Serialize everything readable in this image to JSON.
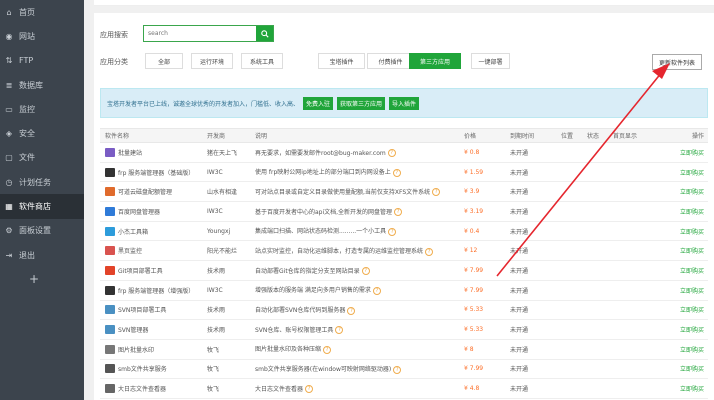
{
  "sidebar": {
    "items": [
      {
        "label": "首页",
        "icon": "home-icon",
        "glyph": "⌂"
      },
      {
        "label": "网站",
        "icon": "globe-icon",
        "glyph": "◉"
      },
      {
        "label": "FTP",
        "icon": "ftp-icon",
        "glyph": "⇅"
      },
      {
        "label": "数据库",
        "icon": "database-icon",
        "glyph": "≣"
      },
      {
        "label": "监控",
        "icon": "monitor-icon",
        "glyph": "▭"
      },
      {
        "label": "安全",
        "icon": "shield-icon",
        "glyph": "◈"
      },
      {
        "label": "文件",
        "icon": "folder-icon",
        "glyph": "▢"
      },
      {
        "label": "计划任务",
        "icon": "clock-icon",
        "glyph": "◷"
      },
      {
        "label": "软件商店",
        "icon": "grid-icon",
        "glyph": "▦"
      },
      {
        "label": "面板设置",
        "icon": "gear-icon",
        "glyph": "⚙"
      },
      {
        "label": "退出",
        "icon": "logout-icon",
        "glyph": "⇥"
      }
    ],
    "active_index": 8,
    "add_glyph": "+"
  },
  "search": {
    "label": "应用搜索",
    "placeholder": "search"
  },
  "categories": {
    "label": "应用分类",
    "items": [
      "全部",
      "运行环境",
      "系统工具",
      "宝塔插件",
      "付费插件",
      "第三方应用",
      "一键部署"
    ],
    "active_index": 5
  },
  "update_button": "更新软件列表",
  "notice": {
    "text": "宝塔开发者平台已上线，诚邀全球优秀的开发者加入，门槛低、收入高、",
    "buttons": [
      "免费入驻",
      "获取第三方应用",
      "导入插件"
    ]
  },
  "table": {
    "headers": [
      "软件名称",
      "开发商",
      "说明",
      "价格",
      "到期时间",
      "位置",
      "状态",
      "首页显示",
      "操作"
    ],
    "rows": [
      {
        "name": "批量建站",
        "dev": "猪在天上飞",
        "desc": "再无要求，如需要发邮件root@bug-maker.com",
        "price": "¥ 0.8",
        "expire": "未开通",
        "op": "立即购买",
        "color": "#7a5cc4"
      },
      {
        "name": "frp 服务端管理器（基础版）",
        "dev": "IW3C",
        "desc": "使用 frp映射公网ip地址上的部分端口到内网设备上",
        "price": "¥ 1.59",
        "expire": "未开通",
        "op": "立即购买",
        "color": "#333333"
      },
      {
        "name": "可道云磁盘配额管理",
        "dev": "山水有相逢",
        "desc": "可对站点目录或自定义目录做使用量配额,当前仅支持XFS文件系统",
        "price": "¥ 3.9",
        "expire": "未开通",
        "op": "立即购买",
        "color": "#e06b2c"
      },
      {
        "name": "百度网盘管理器",
        "dev": "IW3C",
        "desc": "基于百度开发者中心的api文档,全新开发的网盘管理",
        "price": "¥ 3.19",
        "expire": "未开通",
        "op": "立即购买",
        "color": "#2f7bd8"
      },
      {
        "name": "小杰工具箱",
        "dev": "Youngxj",
        "desc": "集成端口扫描、网站状态码检测.........一个小工具",
        "price": "¥ 0.4",
        "expire": "未开通",
        "op": "立即购买",
        "color": "#2d9cdb"
      },
      {
        "name": "黑页监控",
        "dev": "阳光不能烂",
        "desc": "站点实时监控，自动化运维脚本，打造专属的运维监控管理系统",
        "price": "¥ 12",
        "expire": "未开通",
        "op": "立即购买",
        "color": "#d9534f"
      },
      {
        "name": "Git项目部署工具",
        "dev": "技术雨",
        "desc": "自动部署Git仓库的指定分支至网站目录",
        "price": "¥ 7.99",
        "expire": "未开通",
        "op": "立即购买",
        "color": "#e24329"
      },
      {
        "name": "frp 服务端管理器（增强版）",
        "dev": "IW3C",
        "desc": "增强版本的服务端 满足向多用户销售的需求",
        "price": "¥ 7.99",
        "expire": "未开通",
        "op": "立即购买",
        "color": "#333333"
      },
      {
        "name": "SVN项目部署工具",
        "dev": "技术雨",
        "desc": "自动化部署SVN仓库代码到服务器",
        "price": "¥ 5.33",
        "expire": "未开通",
        "op": "立即购买",
        "color": "#4a90c2"
      },
      {
        "name": "SVN管理器",
        "dev": "技术雨",
        "desc": "SVN仓库、账号权限管理工具",
        "price": "¥ 5.33",
        "expire": "未开通",
        "op": "立即购买",
        "color": "#4a90c2"
      },
      {
        "name": "图片批量水印",
        "dev": "牧飞",
        "desc": "图片批量水印及各种压缩",
        "price": "¥ 8",
        "expire": "未开通",
        "op": "立即购买",
        "color": "#777777"
      },
      {
        "name": "smb文件共享服务",
        "dev": "牧飞",
        "desc": "smb文件共享服务器(在window可映射网络驱动器)",
        "price": "¥ 7.99",
        "expire": "未开通",
        "op": "立即购买",
        "color": "#555555"
      },
      {
        "name": "大日志文件查看器",
        "dev": "牧飞",
        "desc": "大日志文件查看器",
        "price": "¥ 4.8",
        "expire": "未开通",
        "op": "立即购买",
        "color": "#666666"
      }
    ]
  },
  "colors": {
    "sidebar_bg": "#3c444d",
    "accent_green": "#20a53a",
    "price_orange": "#fc6d26",
    "arrow_red": "#e5262e"
  }
}
